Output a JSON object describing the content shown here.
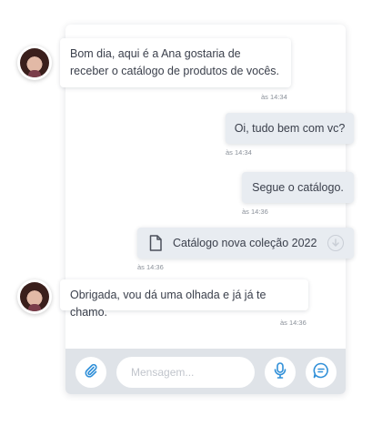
{
  "messages": [
    {
      "direction": "in",
      "text": "Bom dia, aqui é a Ana gostaria de receber o catálogo de produtos de vocês.",
      "time": "às 14:34"
    },
    {
      "direction": "out",
      "text": "Oi, tudo bem com vc?",
      "time": "às 14:34"
    },
    {
      "direction": "out",
      "text": "Segue o catálogo.",
      "time": "às 14:36"
    },
    {
      "direction": "out",
      "type": "file",
      "file_icon": "document-icon",
      "text": "Catálogo nova coleção 2022",
      "action_icon": "download-icon",
      "time": "às 14:36"
    },
    {
      "direction": "in",
      "text": "Obrigada, vou dá uma olhada e já já te chamo.",
      "time": "às 14:36"
    }
  ],
  "composer": {
    "placeholder": "Mensagem...",
    "attach_icon": "paperclip-icon",
    "mic_icon": "microphone-icon",
    "chat_icon": "chat-bubble-icon"
  },
  "colors": {
    "incoming_bubble": "#ffffff",
    "outgoing_bubble": "#e8ecf1",
    "icon_blue": "#2f8fd8",
    "composer_bar": "#dfe3e8"
  }
}
